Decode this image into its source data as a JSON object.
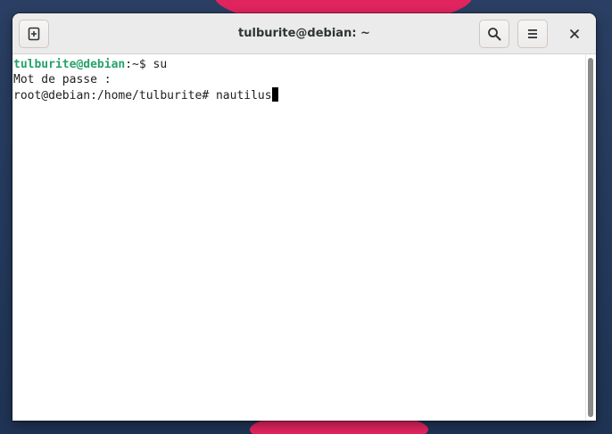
{
  "window": {
    "title": "tulburite@debian: ~"
  },
  "headerbar": {
    "new_tab_icon": "new-tab-icon",
    "search_icon": "search-icon",
    "menu_icon": "hamburger-menu-icon",
    "close_icon": "close-icon"
  },
  "terminal": {
    "lines": [
      {
        "user_host": "tulburite@debian",
        "rest": ":~$ su"
      },
      {
        "text": "Mot de passe :"
      },
      {
        "text": "root@debian:/home/tulburite# nautilus"
      }
    ]
  },
  "colors": {
    "prompt_green": "#26a269",
    "desktop_accent": "#e0245e"
  }
}
